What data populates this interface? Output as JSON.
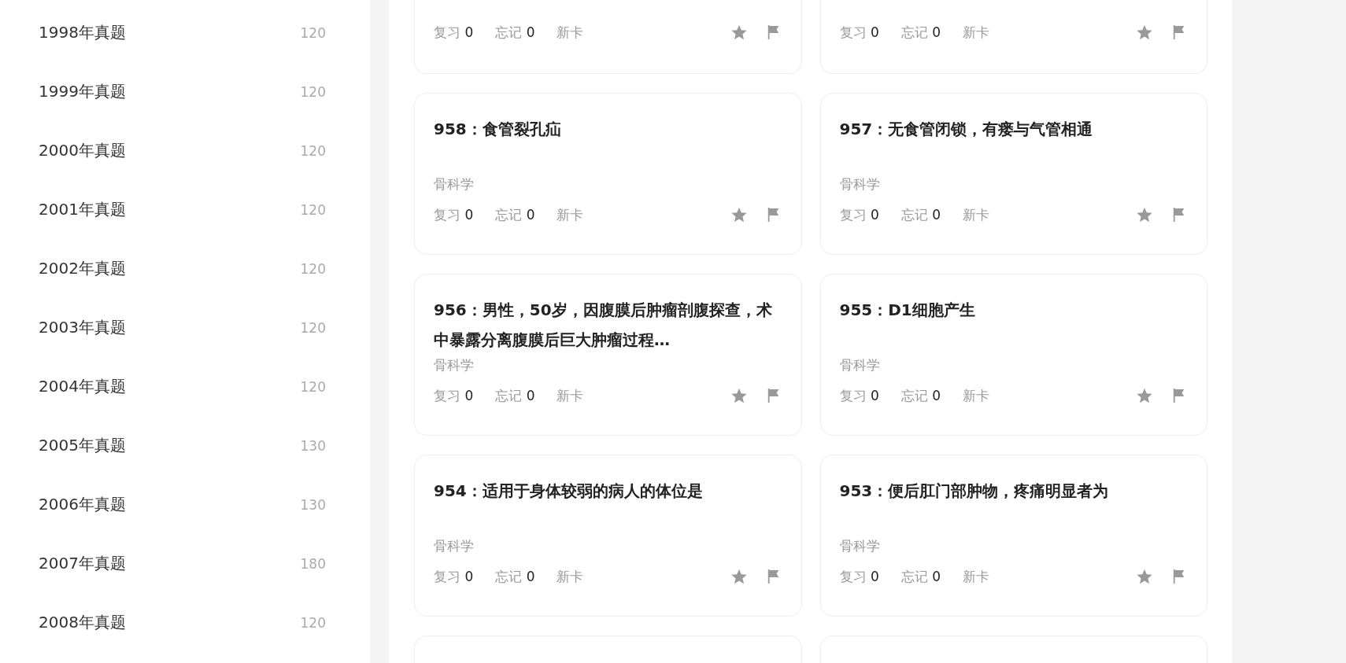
{
  "sidebar": {
    "items": [
      {
        "label": "1998年真题",
        "count": "120"
      },
      {
        "label": "1999年真题",
        "count": "120"
      },
      {
        "label": "2000年真题",
        "count": "120"
      },
      {
        "label": "2001年真题",
        "count": "120"
      },
      {
        "label": "2002年真题",
        "count": "120"
      },
      {
        "label": "2003年真题",
        "count": "120"
      },
      {
        "label": "2004年真题",
        "count": "120"
      },
      {
        "label": "2005年真题",
        "count": "130"
      },
      {
        "label": "2006年真题",
        "count": "130"
      },
      {
        "label": "2007年真题",
        "count": "180"
      },
      {
        "label": "2008年真题",
        "count": "120"
      }
    ]
  },
  "cards": [
    {
      "kind": "tail",
      "stats": [
        {
          "label": "复习",
          "value": "0"
        },
        {
          "label": "忘记",
          "value": "0"
        },
        {
          "label": "新卡"
        }
      ]
    },
    {
      "kind": "tail",
      "stats": [
        {
          "label": "复习",
          "value": "0"
        },
        {
          "label": "忘记",
          "value": "0"
        },
        {
          "label": "新卡"
        }
      ]
    },
    {
      "kind": "full",
      "title": "958：食管裂孔疝",
      "category": "骨科学",
      "stats": [
        {
          "label": "复习",
          "value": "0"
        },
        {
          "label": "忘记",
          "value": "0"
        },
        {
          "label": "新卡"
        }
      ]
    },
    {
      "kind": "full",
      "title": "957：无食管闭锁，有瘘与气管相通",
      "category": "骨科学",
      "stats": [
        {
          "label": "复习",
          "value": "0"
        },
        {
          "label": "忘记",
          "value": "0"
        },
        {
          "label": "新卡"
        }
      ]
    },
    {
      "kind": "full",
      "title": "956：男性，50岁，因腹膜后肿瘤剖腹探查，术中暴露分离腹膜后巨大肿瘤过程…",
      "category": "骨科学",
      "stats": [
        {
          "label": "复习",
          "value": "0"
        },
        {
          "label": "忘记",
          "value": "0"
        },
        {
          "label": "新卡"
        }
      ]
    },
    {
      "kind": "full",
      "title": "955：D1细胞产生",
      "category": "骨科学",
      "stats": [
        {
          "label": "复习",
          "value": "0"
        },
        {
          "label": "忘记",
          "value": "0"
        },
        {
          "label": "新卡"
        }
      ]
    },
    {
      "kind": "full",
      "title": "954：适用于身体较弱的病人的体位是",
      "category": "骨科学",
      "stats": [
        {
          "label": "复习",
          "value": "0"
        },
        {
          "label": "忘记",
          "value": "0"
        },
        {
          "label": "新卡"
        }
      ]
    },
    {
      "kind": "full",
      "title": "953：便后肛门部肿物，疼痛明显者为",
      "category": "骨科学",
      "stats": [
        {
          "label": "复习",
          "value": "0"
        },
        {
          "label": "忘记",
          "value": "0"
        },
        {
          "label": "新卡"
        }
      ]
    },
    {
      "kind": "head"
    },
    {
      "kind": "head"
    }
  ]
}
